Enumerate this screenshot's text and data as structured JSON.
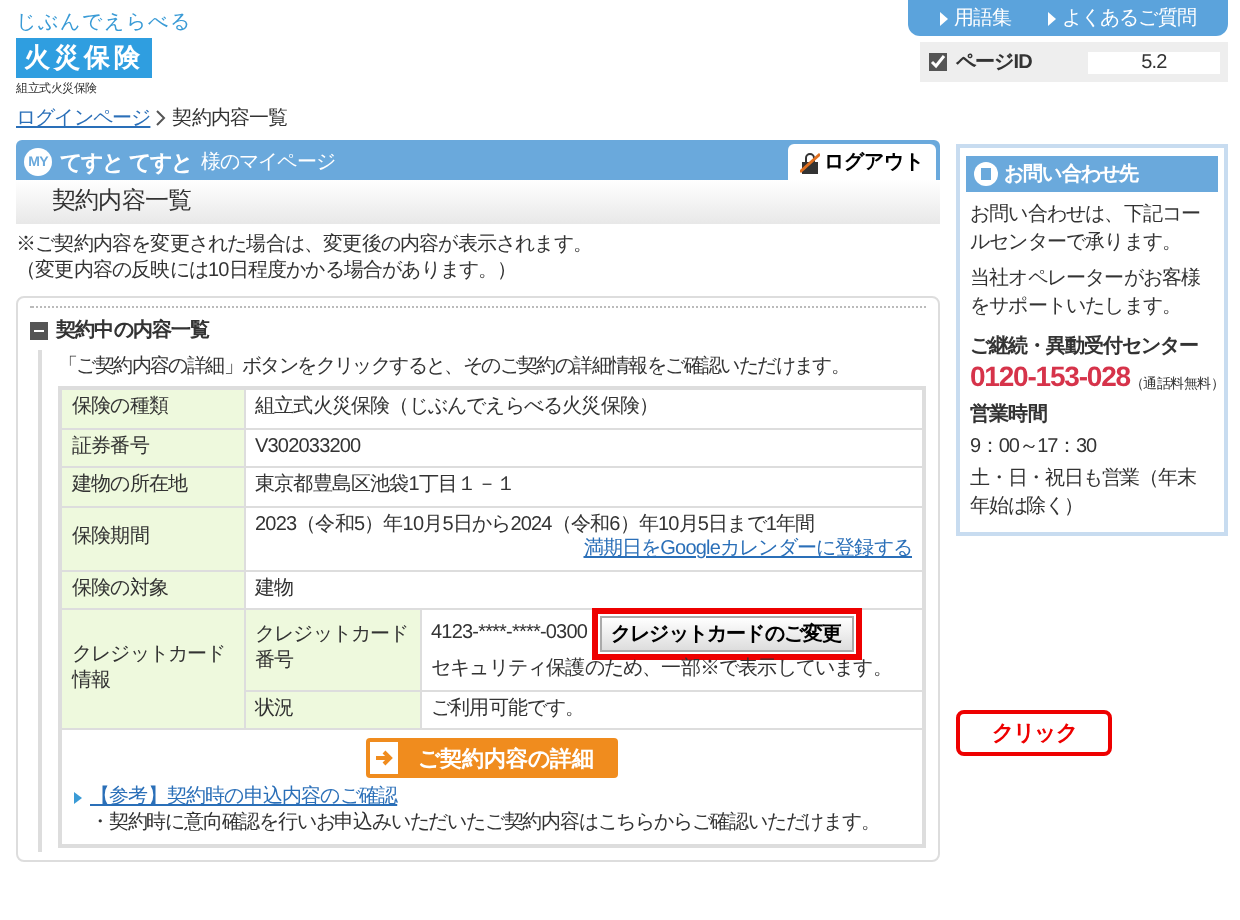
{
  "logo": {
    "tagline": "じぶんでえらべる",
    "name": "火災保険",
    "sub": "組立式火災保険"
  },
  "top_links": [
    "用語集",
    "よくあるご質問"
  ],
  "page_id": {
    "label": "ページID",
    "value": "5.2"
  },
  "breadcrumb": {
    "link": "ログインページ",
    "current": "契約内容一覧"
  },
  "mypage": {
    "badge": "MY",
    "user": "てすと てすと",
    "suffix": "様のマイページ",
    "logout": "ログアウト"
  },
  "page_title": "契約内容一覧",
  "notes": [
    "※ご契約内容を変更された場合は、変更後の内容が表示されます。",
    "（変更内容の反映には10日程度かかる場合があります。）"
  ],
  "section": {
    "title": "契約中の内容一覧",
    "expanded": true,
    "intro": "「ご契約内容の詳細」ボタンをクリックすると、そのご契約の詳細情報をご確認いただけます。",
    "rows": [
      {
        "label": "保険の種類",
        "value": "組立式火災保険（じぶんでえらべる火災保険）"
      },
      {
        "label": "証券番号",
        "value": "V302033200"
      },
      {
        "label": "建物の所在地",
        "value": "東京都豊島区池袋1丁目１－１"
      },
      {
        "label": "保険期間",
        "value": "2023（令和5）年10月5日から2024（令和6）年10月5日まで1年間",
        "link": "満期日をGoogleカレンダーに登録する"
      },
      {
        "label": "保険の対象",
        "value": "建物"
      },
      {
        "label": "クレジットカード情報",
        "subrows": [
          {
            "label": "クレジットカード番号",
            "value": "4123-****-****-0300",
            "note": "セキュリティ保護のため、一部※で表示しています。",
            "button": "クレジットカードのご変更"
          },
          {
            "label": "状況",
            "value": "ご利用可能です。"
          }
        ]
      }
    ],
    "detail_button": "ご契約内容の詳細",
    "reference_link": "【参考】契約時の申込内容のご確認",
    "reference_note": "・契約時に意向確認を行いお申込みいただいたご契約内容はこちらからご確認いただけます。"
  },
  "callout": "クリック",
  "contact": {
    "title": "お問い合わせ先",
    "paragraphs": [
      "お問い合わせは、下記コールセンターで承ります。",
      "当社オペレーターがお客様をサポートいたします。"
    ],
    "center": "ご継続・異動受付センター",
    "phone": "0120-153-028",
    "phone_note": "（通話料無料）",
    "hours_label": "営業時間",
    "hours": "9：00～17：30",
    "days": "土・日・祝日も営業（年末年始は除く）"
  }
}
